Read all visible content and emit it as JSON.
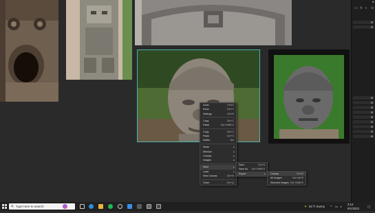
{
  "window": {
    "close_glyph": "×"
  },
  "context_menu": {
    "items": [
      {
        "label": "Undo",
        "shortcut": "Ctrl+Z"
      },
      {
        "label": "Redo",
        "shortcut": "Ctrl+Y"
      },
      {
        "label": "Settings",
        "shortcut": "Ctrl+E"
      },
      {
        "sep": true
      },
      {
        "label": "Copy",
        "shortcut": "Ctrl+C"
      },
      {
        "label": "Paste",
        "shortcut": "Ctrl+Shift+V"
      },
      {
        "sep": true
      },
      {
        "label": "Copy",
        "shortcut": "Ctrl+C"
      },
      {
        "label": "Paste",
        "shortcut": "Ctrl+V"
      },
      {
        "label": "Delete",
        "shortcut": "Del"
      },
      {
        "sep": true
      },
      {
        "label": "Mode",
        "submenu": true
      },
      {
        "label": "Window",
        "submenu": true
      },
      {
        "label": "Canvas",
        "submenu": true
      },
      {
        "label": "Images",
        "submenu": true
      },
      {
        "sep": true
      },
      {
        "label": "Save",
        "submenu": true,
        "highlight": true
      },
      {
        "label": "Load",
        "submenu": true
      },
      {
        "label": "New Canvas",
        "shortcut": "Ctrl+N"
      },
      {
        "sep": true
      },
      {
        "label": "Close",
        "shortcut": "Ctrl+Q"
      }
    ]
  },
  "save_submenu": {
    "items": [
      {
        "label": "Save",
        "shortcut": "Ctrl+S"
      },
      {
        "label": "Save As",
        "shortcut": "Ctrl+Shift+S"
      },
      {
        "label": "Export",
        "submenu": true,
        "highlight": true
      }
    ]
  },
  "export_submenu": {
    "items": [
      {
        "label": "Canvas",
        "shortcut": "Ctrl+E",
        "highlight": true
      },
      {
        "label": "All Images",
        "shortcut": "Ctrl+Alt+E"
      },
      {
        "label": "Selected Images",
        "shortcut": "Ctrl+Shift+E"
      }
    ]
  },
  "taskbar": {
    "search_placeholder": "Type here to search",
    "weather": "81°F Sunny",
    "time": "3:14",
    "date": "9/1/2022"
  },
  "colors": {
    "selection": "#4bb3b0",
    "menu_bg": "#2d2d2d",
    "taskbar_bg": "#202020"
  }
}
